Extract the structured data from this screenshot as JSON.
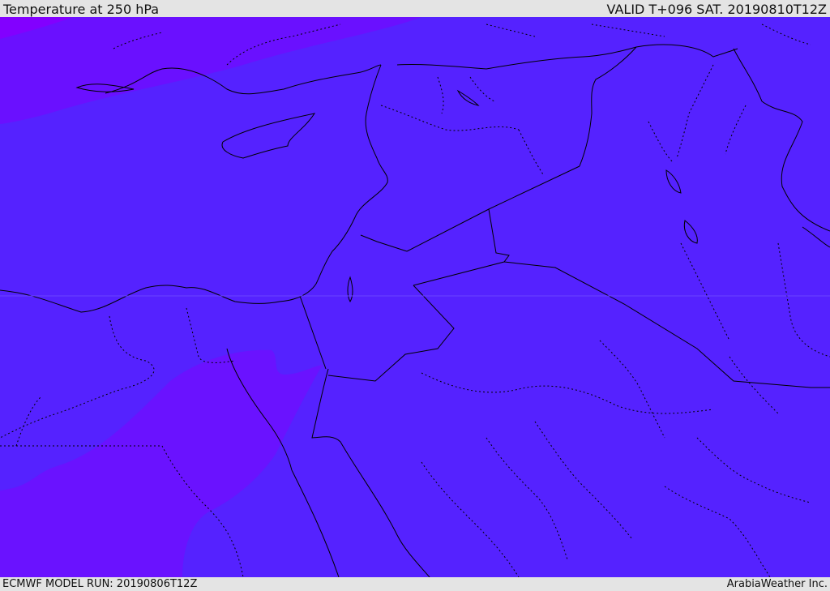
{
  "header": {
    "title": "Temperature at 250 hPa",
    "valid_time": "VALID T+096 SAT. 20190810T12Z"
  },
  "footer": {
    "model_run": "ECMWF MODEL RUN: 20190806T12Z",
    "credit": "ArabiaWeather Inc."
  },
  "map": {
    "colors": {
      "background_fill": "#5522ff",
      "warm_band_fill": "#6a12ff",
      "coldest_fill": "#8a00ff",
      "coastline": "#000000",
      "border": "#000000"
    }
  }
}
